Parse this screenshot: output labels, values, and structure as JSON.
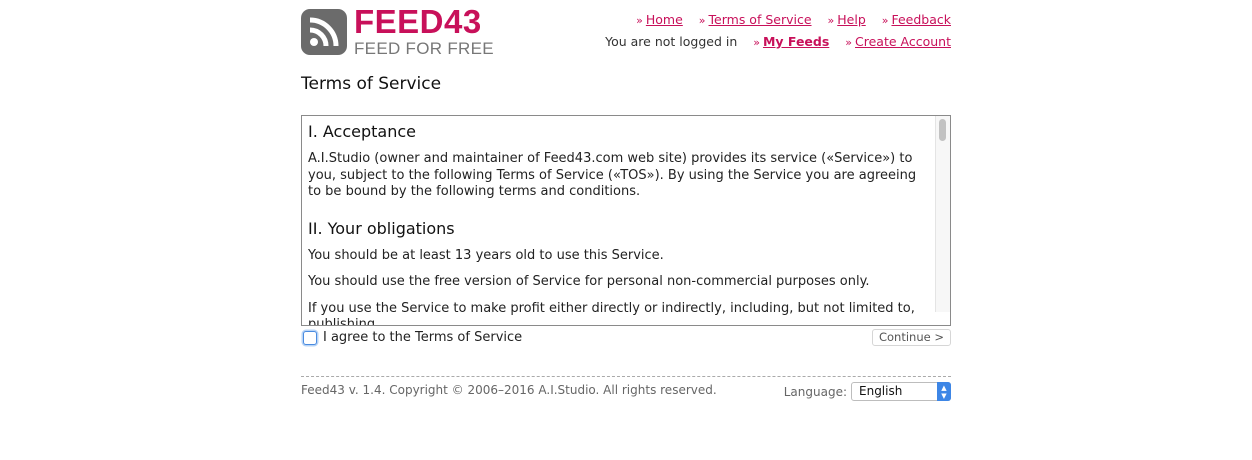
{
  "header": {
    "logo_title": "FEED43",
    "logo_subtitle": "FEED FOR FREE",
    "logo_icon": "rss-icon",
    "nav": {
      "home": "Home",
      "terms": "Terms of Service",
      "help": "Help",
      "feedback": "Feedback",
      "status": "You are not logged in",
      "my_feeds": "My Feeds",
      "create_account": "Create Account",
      "separator": "»"
    }
  },
  "page_title": "Terms of Service",
  "terms": {
    "section1_title": "I. Acceptance",
    "section1_text": "A.I.Studio (owner and maintainer of Feed43.com web site) provides its service («Service») to you, subject to the following Terms of Service («TOS»). By using the Service you are agreeing to be bound by the following terms and conditions.",
    "section2_title": "II. Your obligations",
    "section2_p1": "You should be at least 13 years old to use this Service.",
    "section2_p2": "You should use the free version of Service for personal non-commercial purposes only.",
    "section2_p3": "If you use the Service to make profit either directly or indirectly, including, but not limited to, publishing"
  },
  "agree": {
    "label": "I agree to the Terms of Service",
    "checked": false
  },
  "continue_label": "Continue >",
  "footer": {
    "copyright": "Feed43 v. 1.4. Copyright © 2006–2016 A.I.Studio. All rights reserved.",
    "language_label": "Language:",
    "language_value": "English"
  },
  "colors": {
    "brand": "#c8105a",
    "logo_gray": "#6b6b6b",
    "select_accent": "#3d86e6"
  }
}
